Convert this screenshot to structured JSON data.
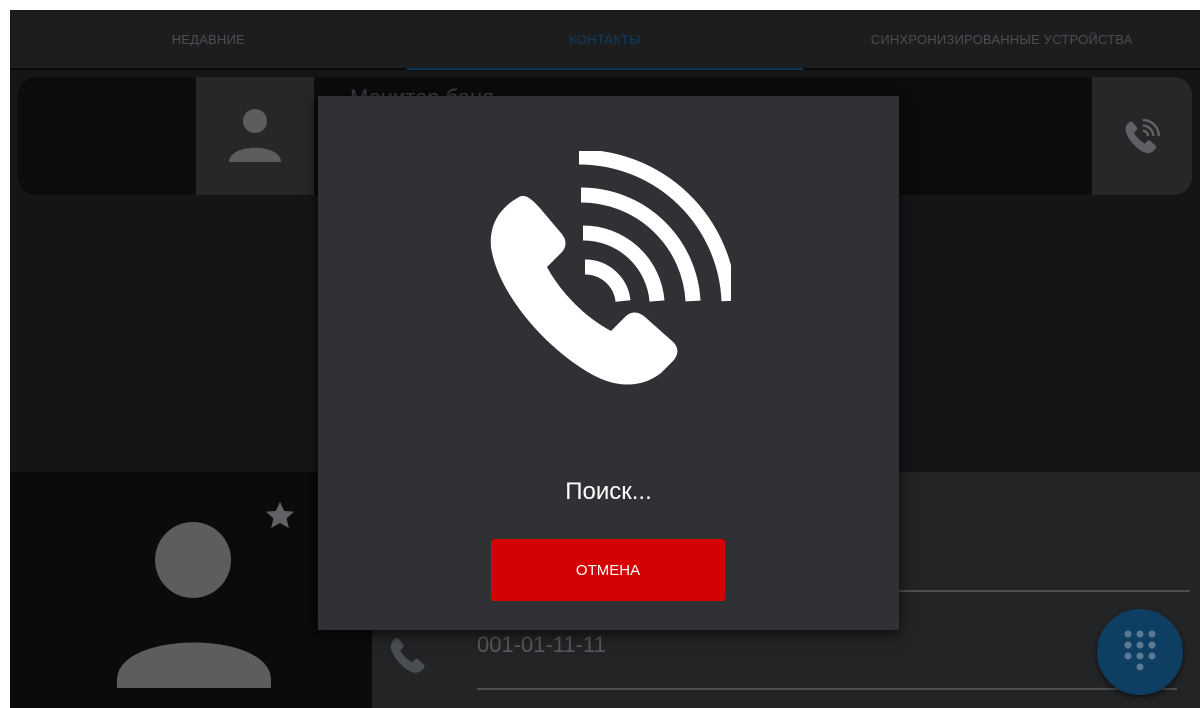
{
  "tabs": [
    {
      "label": "НЕДАВНИЕ",
      "active": false
    },
    {
      "label": "КОНТАКТЫ",
      "active": true
    },
    {
      "label": "СИНХРОНИЗИРОВАННЫЕ УСТРОЙСТВА",
      "active": false
    }
  ],
  "contact": {
    "name": "Монитор баня",
    "phone": "001-01-11-11"
  },
  "dialog": {
    "status": "Поиск...",
    "cancel_label": "ОТМЕНА"
  },
  "icons": {
    "card_avatar": "person-icon",
    "card_call": "phone-ringing-icon",
    "dialog": "phone-ringing-icon",
    "favorite": "star-icon",
    "detail_avatar": "person-icon",
    "detail_phone": "phone-icon",
    "fab": "dialpad-icon"
  },
  "colors": {
    "accent": "#0f3e63",
    "cancel": "#d40202",
    "dialog_bg": "#2f3135"
  }
}
